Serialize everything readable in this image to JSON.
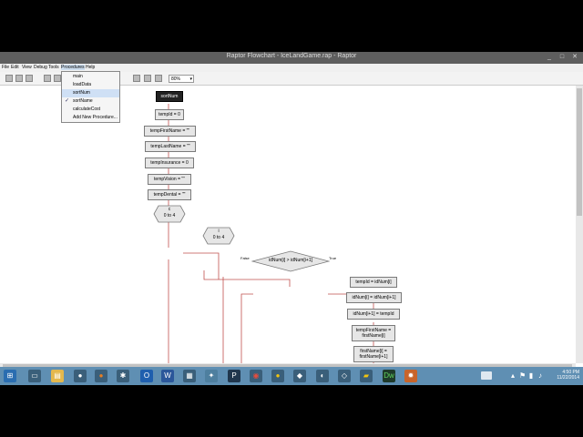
{
  "window": {
    "title": "Raptor Flowchart - IceLandGame.rap - Raptor"
  },
  "menu": [
    "File",
    "Edit",
    "View",
    "Debug",
    "Tools",
    "Procedures",
    "Help"
  ],
  "toolbar": {
    "zoom": "80%"
  },
  "procedures_menu": {
    "items": [
      {
        "label": "main",
        "selected": false,
        "checked": false
      },
      {
        "label": "loadData",
        "selected": false,
        "checked": false
      },
      {
        "label": "sortNum",
        "selected": true,
        "checked": false
      },
      {
        "label": "sortName",
        "selected": false,
        "checked": true
      },
      {
        "label": "calculateCost",
        "selected": false,
        "checked": false
      },
      {
        "label": "Add New Procedure...",
        "selected": false,
        "checked": false
      }
    ]
  },
  "flowchart": {
    "start": "sortNum",
    "assignments": [
      "tempId = 0",
      "tempFirstName = \"\"",
      "tempLastName = \"\"",
      "tempInsurance = 0",
      "tempVision = \"\"",
      "tempDental = \"\""
    ],
    "loop1": {
      "var": "c",
      "range": "0 to 4"
    },
    "loop2": {
      "var": "i",
      "range": "0 to 4"
    },
    "decision": "idNum[i] > idNum[i+1]",
    "false_label": "False",
    "true_label": "True",
    "true_branch": [
      "tempId = idNum[i]",
      "idNum[i] = idNum[i+1]",
      "idNum[i+1] = tempId",
      "tempFirstName = firstName[i]",
      "firstName[i] = firstName[i+1]"
    ]
  },
  "taskbar": {
    "time": "4:50 PM",
    "date": "11/22/2014"
  }
}
